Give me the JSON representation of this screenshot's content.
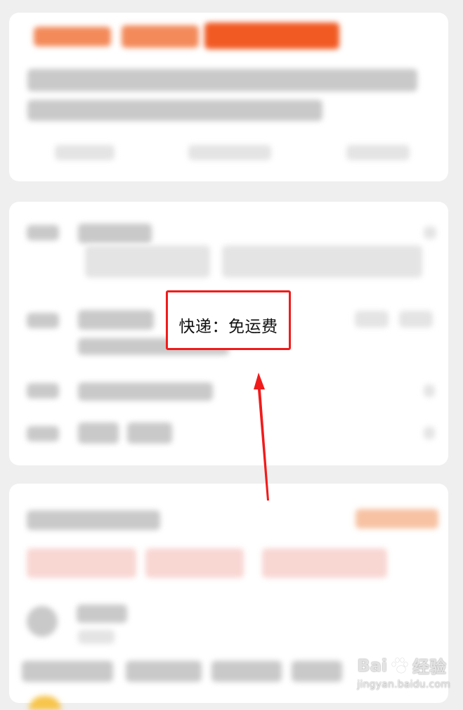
{
  "annotation": {
    "text": "快递：免运费"
  },
  "watermark": {
    "brand": "Bai",
    "brand_suffix": "经验",
    "url": "jingyan.baidu.com"
  },
  "colors": {
    "annotation_border": "#f11b1b",
    "accent_orange": "#f15a22"
  },
  "icons": {
    "annotation_arrow": "red-arrow-icon",
    "watermark_logo": "paw-icon"
  }
}
